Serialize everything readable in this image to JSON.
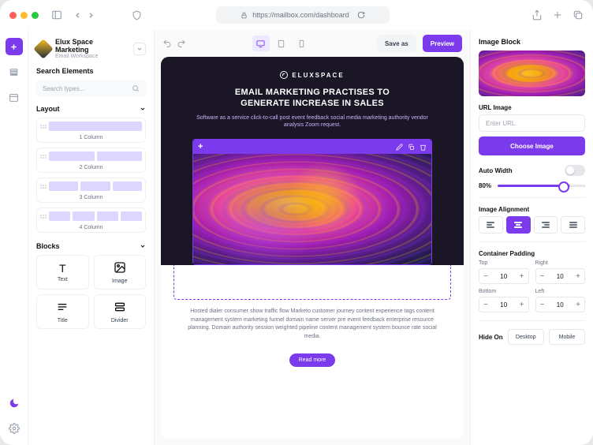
{
  "url": "https://mailbox.com/dashboard",
  "workspace": {
    "title": "Elux Space Marketing",
    "subtitle": "Email Workspace"
  },
  "search": {
    "label": "Search Elements",
    "placeholder": "Search types..."
  },
  "layout": {
    "label": "Layout",
    "items": [
      {
        "label": "1 Column",
        "cols": 1
      },
      {
        "label": "2 Column",
        "cols": 2
      },
      {
        "label": "3 Column",
        "cols": 3
      },
      {
        "label": "4 Column",
        "cols": 4
      }
    ]
  },
  "blocks": {
    "label": "Blocks",
    "items": [
      "Text",
      "Image",
      "Title",
      "Divider"
    ]
  },
  "toolbar": {
    "save": "Save as",
    "preview": "Preview"
  },
  "hero": {
    "brand": "ELUXSPACE",
    "headline1": "EMAIL MARKETING PRACTISES TO",
    "headline2": "GENERATE INCREASE IN SALES",
    "sub": "Software as a service click-to-call post event feedback social media marketing authority vendor analysis Zoom request."
  },
  "body": {
    "para": "Hosted dialer consumer show traffic flow Marketo customer journey content experience tags content management system marketing funnel domain name server pre event feedback enterprise resource planning. Domain authority session weighted pipeline content management system bounce rate social media.",
    "readmore": "Read more"
  },
  "rightPanel": {
    "block": "Image Block",
    "urlImage": "URL Image",
    "urlPlaceholder": "Enter URL",
    "choose": "Choose Image",
    "autoWidth": "Auto Width",
    "widthValue": "80%",
    "alignment": "Image Alignment",
    "padding": {
      "label": "Container Padding",
      "top": "Top",
      "right": "Right",
      "bottom": "Bottom",
      "left": "Left",
      "value": "10"
    },
    "hideOn": {
      "label": "Hide On",
      "desktop": "Desktop",
      "mobile": "Mobile"
    }
  }
}
